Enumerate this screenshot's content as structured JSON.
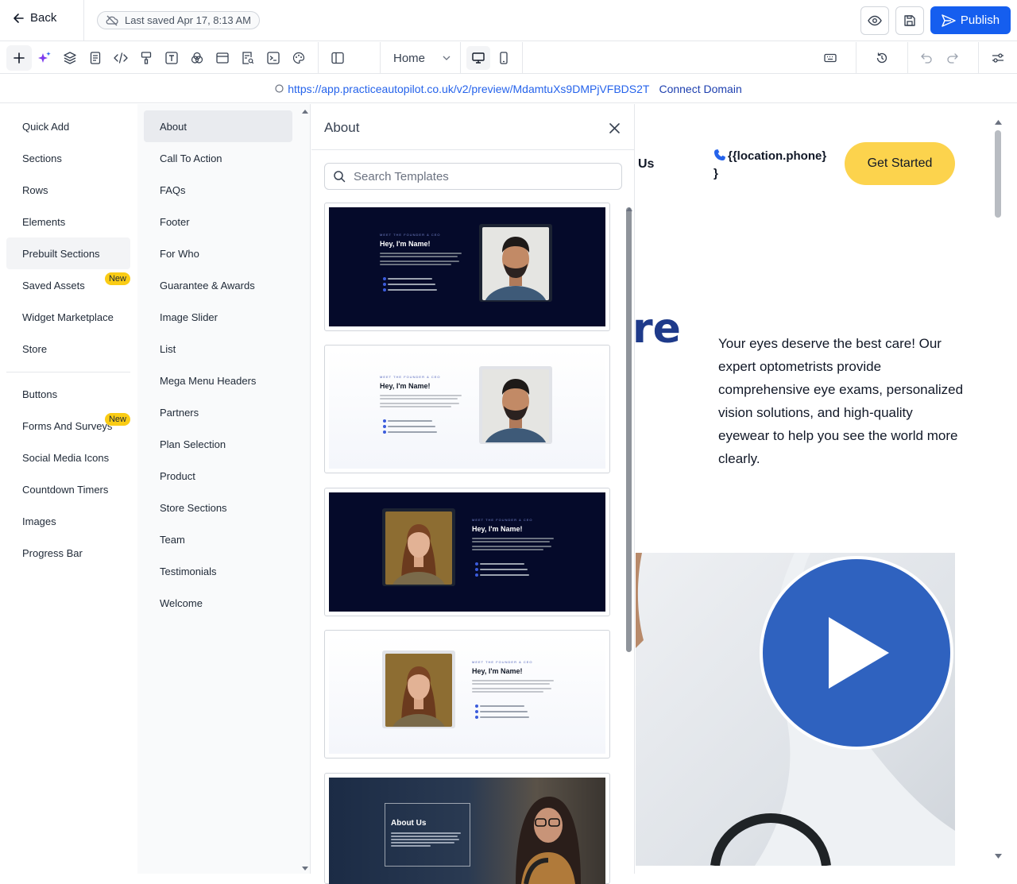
{
  "topbar": {
    "back_label": "Back",
    "last_saved": "Last saved Apr 17, 8:13 AM",
    "publish_label": "Publish"
  },
  "toolbar": {
    "page_select": "Home"
  },
  "urlbar": {
    "preview_url": "https://app.practiceautopilot.co.uk/v2/preview/MdamtuXs9DMPjVFBDS2T",
    "connect_label": "Connect Domain"
  },
  "categories": [
    {
      "label": "Quick Add"
    },
    {
      "label": "Sections"
    },
    {
      "label": "Rows"
    },
    {
      "label": "Elements"
    },
    {
      "label": "Prebuilt Sections",
      "active": true
    },
    {
      "label": "Saved Assets",
      "badge": "New"
    },
    {
      "label": "Widget Marketplace"
    },
    {
      "label": "Store"
    }
  ],
  "categories_secondary": [
    {
      "label": "Buttons"
    },
    {
      "label": "Forms And Surveys",
      "badge": "New"
    },
    {
      "label": "Social Media Icons"
    },
    {
      "label": "Countdown Timers"
    },
    {
      "label": "Images"
    },
    {
      "label": "Progress Bar"
    }
  ],
  "subcategories": [
    {
      "label": "About",
      "active": true
    },
    {
      "label": "Call To Action"
    },
    {
      "label": "FAQs"
    },
    {
      "label": "Footer"
    },
    {
      "label": "For Who"
    },
    {
      "label": "Guarantee & Awards"
    },
    {
      "label": "Image Slider"
    },
    {
      "label": "List"
    },
    {
      "label": "Mega Menu Headers"
    },
    {
      "label": "Partners"
    },
    {
      "label": "Plan Selection"
    },
    {
      "label": "Product"
    },
    {
      "label": "Store Sections"
    },
    {
      "label": "Team"
    },
    {
      "label": "Testimonials"
    },
    {
      "label": "Welcome"
    }
  ],
  "panel": {
    "title": "About",
    "search_placeholder": "Search Templates",
    "templates": [
      {
        "eyebrow": "MEET THE FOUNDER & CEO",
        "title": "Hey, I'm Name!",
        "theme": "dark"
      },
      {
        "eyebrow": "MEET THE FOUNDER & CEO",
        "title": "Hey, I'm Name!",
        "theme": "light"
      },
      {
        "eyebrow": "MEET THE FOUNDER & CEO",
        "title": "Hey, I'm Name!",
        "theme": "dark"
      },
      {
        "eyebrow": "MEET THE FOUNDER & CEO",
        "title": "Hey, I'm Name!",
        "theme": "light"
      },
      {
        "title": "About Us",
        "theme": "photo"
      }
    ]
  },
  "canvas": {
    "nav_fragment": "Us",
    "phone": "{{location.phone}\n}",
    "cta_label": "Get Started",
    "hero_fragment": "re",
    "hero_text": "Your eyes deserve the best care! Our expert optometrists provide comprehensive eye exams, personalized vision solutions, and high-quality eyewear to help you see the world more clearly."
  },
  "colors": {
    "accent": "#155eef",
    "badge": "#facc15",
    "cta": "#fcd34d",
    "play": "#2f62bf",
    "template_dark": "#050a2a"
  }
}
